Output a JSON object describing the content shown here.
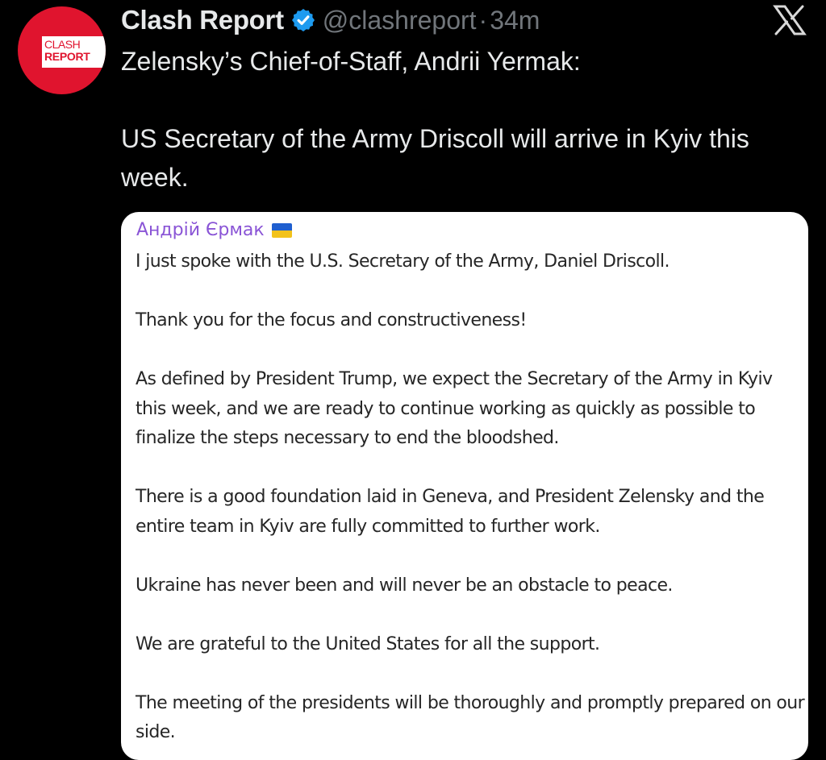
{
  "author": {
    "display_name": "Clash Report",
    "handle": "@clashreport",
    "separator": "·",
    "time": "34m",
    "avatar_text_line1": "CLASH",
    "avatar_text_line2": "REPORT",
    "verified_icon": "verified-badge-icon",
    "brand_color": "#e0142e",
    "verified_color": "#1d9bf0"
  },
  "platform_icon": "x-logo-icon",
  "tweet": {
    "line1": "Zelensky’s Chief-of-Staff, Andrii Yermak:",
    "line2": "US Secretary of the Army Driscoll will arrive in Kyiv this week."
  },
  "media": {
    "channel_name": "Андрій Єрмак",
    "channel_flag_icon": "ukraine-flag-icon",
    "channel_color": "#8a55d6",
    "paragraphs": [
      "I just spoke with the U.S. Secretary of the Army, Daniel Driscoll.",
      "Thank you for the focus and constructiveness!",
      "As defined by President Trump, we expect the Secretary of the Army in Kyiv this week, and we are ready to continue working as quickly as possible to finalize the steps necessary to end the bloodshed.",
      "There is a good foundation laid in Geneva, and President Zelensky and the entire team in Kyiv are fully committed to further work.",
      "Ukraine has never been and will never be an obstacle to peace.",
      "We are grateful to the United States for all the support.",
      "The meeting of the presidents will be thoroughly and promptly prepared on our side."
    ]
  }
}
